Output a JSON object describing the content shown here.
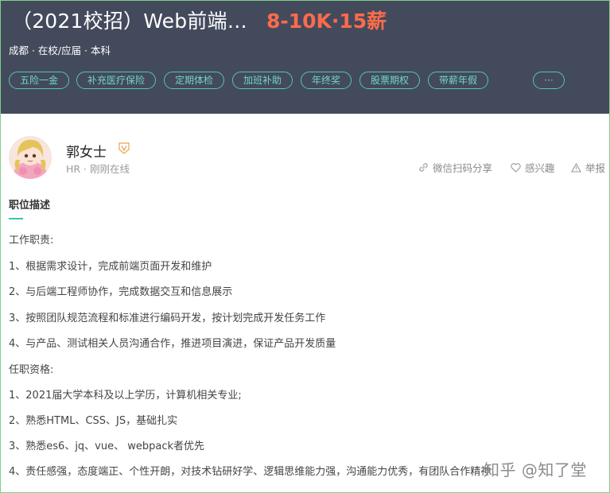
{
  "job": {
    "title": "（2021校招）Web前端…",
    "salary": "8-10K·15薪",
    "meta": "成都 · 在校/应届 · 本科",
    "tags": [
      "五险一金",
      "补充医疗保险",
      "定期体检",
      "加班补助",
      "年终奖",
      "股票期权",
      "带薪年假",
      "···"
    ]
  },
  "recruiter": {
    "name": "郭女士",
    "status": "HR  ·  刚刚在线"
  },
  "actions": {
    "share": "微信扫码分享",
    "interest": "感兴趣",
    "report": "举报"
  },
  "description": {
    "title": "职位描述",
    "lines": [
      "工作职责:",
      "1、根据需求设计，完成前端页面开发和维护",
      "2、与后端工程师协作，完成数据交互和信息展示",
      "3、按照团队规范流程和标准进行编码开发，按计划完成开发任务工作",
      "4、与产品、测试相关人员沟通合作，推进项目演进，保证产品开发质量",
      "任职资格:",
      "1、2021届大学本科及以上学历，计算机相关专业;",
      "2、熟悉HTML、CSS、JS，基础扎实",
      "3、熟悉es6、jq、vue、 webpack者优先",
      "4、责任感强，态度端正、个性开朗，对技术钻研好学、逻辑思维能力强，沟通能力优秀，有团队合作精神"
    ]
  },
  "watermark": "知乎 @知了堂",
  "colors": {
    "header_bg": "#434a5c",
    "salary": "#ff6b4a",
    "tag": "#55c5b5",
    "accent": "#33c6b3"
  }
}
